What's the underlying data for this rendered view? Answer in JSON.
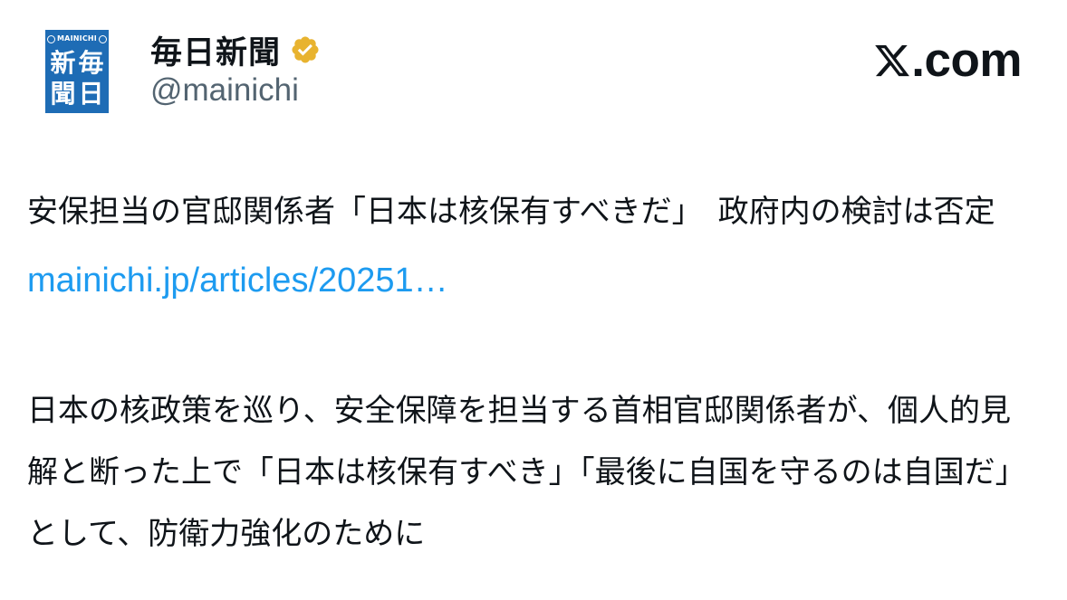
{
  "account": {
    "name": "毎日新聞",
    "handle": "@mainichi",
    "verified_icon": "verified-badge-icon",
    "verified_color": "#e8b32f",
    "avatar": {
      "brand_word": "MAINICHI",
      "kanji": [
        "新",
        "毎",
        "聞",
        "日"
      ],
      "background": "#1e6cb5"
    }
  },
  "site": {
    "domain": ".com",
    "logo_icon": "x-logo-icon"
  },
  "post": {
    "headline": "安保担当の官邸関係者「日本は核保有すべきだ」　政府内の検討は否定",
    "link_text": "mainichi.jp/articles/20251…",
    "link_color": "#1d9bf0",
    "body": "日本の核政策を巡り、安全保障を担当する首相官邸関係者が、個人的見解と断った上で「日本は核保有すべき」「最後に自国を守るのは自国だ」として、防衛力強化のために"
  }
}
